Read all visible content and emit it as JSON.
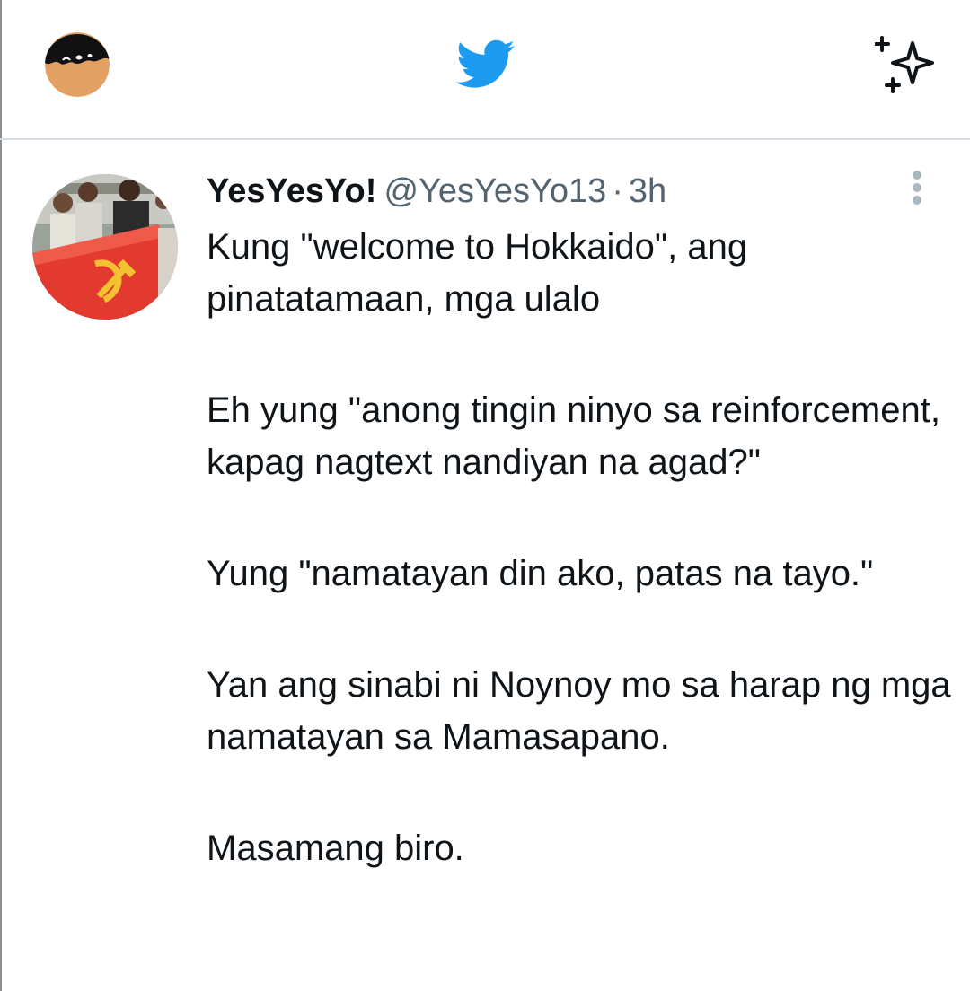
{
  "colors": {
    "brand_blue": "#1d9bf0",
    "text_primary": "#0f1419",
    "text_secondary": "#536471",
    "divider": "#d5dbe0"
  },
  "top_bar": {
    "left_icon": "profile-avatar",
    "center_icon": "twitter-bird-icon",
    "right_icon": "sparkle-timeline-icon"
  },
  "tweet": {
    "display_name": "YesYesYo!",
    "handle": "@YesYesYo13",
    "separator": "·",
    "time": "3h",
    "more_icon": "more-vertical-icon",
    "paragraphs": [
      "Kung \"welcome to Hokkaido\", ang pinatatamaan, mga ulalo",
      "Eh yung \"anong tingin ninyo sa reinforcement, kapag nagtext nandiyan na agad?\"",
      "Yung \"namatayan din ako, patas na tayo.\"",
      "Yan ang sinabi ni Noynoy mo sa harap ng mga namatayan sa Mamasapano.",
      "Masamang biro."
    ]
  }
}
